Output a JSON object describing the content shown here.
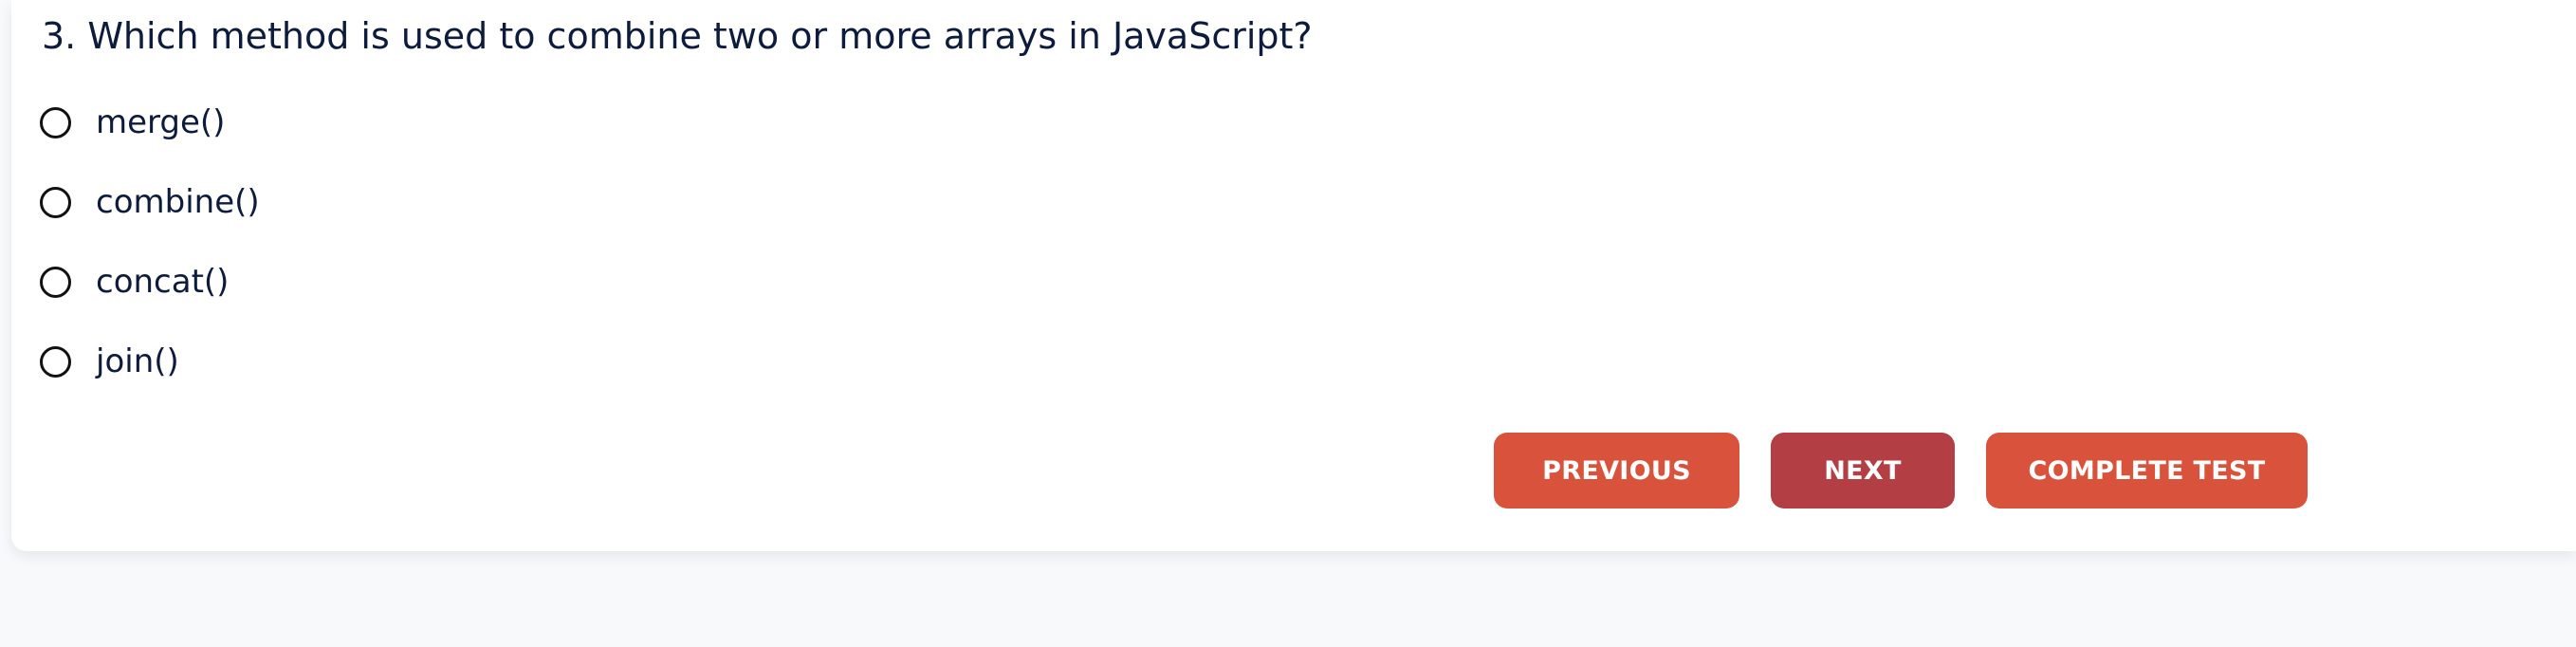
{
  "question": {
    "text": "3. Which method is used to combine two or more arrays in JavaScript?"
  },
  "options": [
    {
      "label": "merge()",
      "selected": false
    },
    {
      "label": "combine()",
      "selected": false
    },
    {
      "label": "concat()",
      "selected": false
    },
    {
      "label": "join()",
      "selected": false
    }
  ],
  "buttons": {
    "previous": "PREVIOUS",
    "next": "NEXT",
    "complete": "COMPLETE TEST"
  },
  "colors": {
    "primary_button": "#d9533c",
    "next_button": "#b33f44",
    "text": "#0d1b3d",
    "page_background": "#f8f9fb"
  }
}
